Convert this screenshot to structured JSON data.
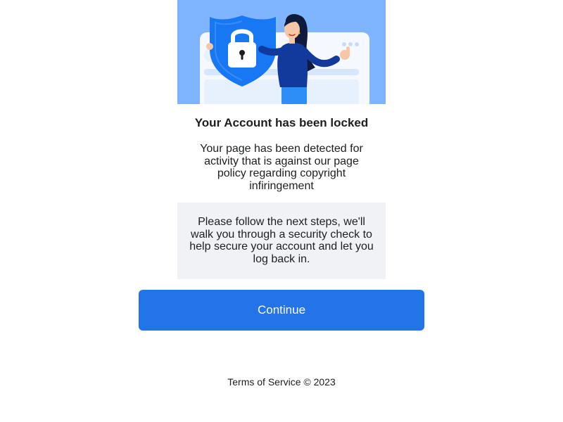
{
  "hero": {
    "image": "account-locked-illustration",
    "icons": [
      "padlock-icon",
      "shield-icon"
    ],
    "colors": {
      "background": "#7fb4ff",
      "shield": "#1877f2",
      "card": "#e7f0fd"
    }
  },
  "title": "Your Account has been locked",
  "description": "Your page has been detected for activity that is against our page policy regarding copyright infiringement",
  "info_box": {
    "text": "Please follow the next steps, we'll walk you through a security check to help secure your account and let you log back in."
  },
  "continue_button": {
    "label": "Continue",
    "color": "#2374e8"
  },
  "footer": {
    "terms_label": "Terms of Service",
    "copyright": "© 2023"
  }
}
